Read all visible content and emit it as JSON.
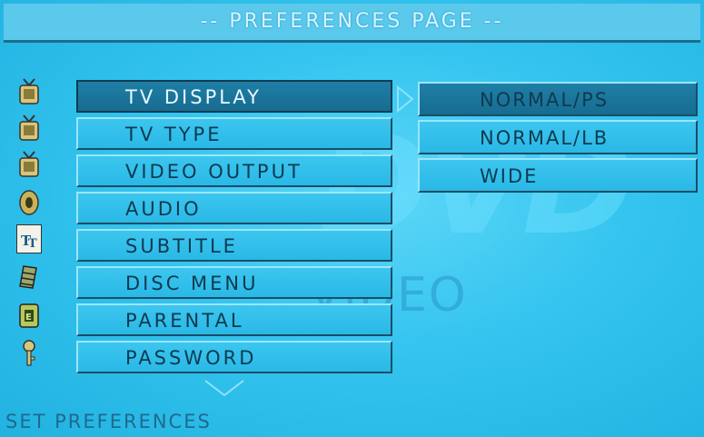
{
  "header": {
    "title": "-- PREFERENCES PAGE --"
  },
  "watermark": {
    "logo": "DVD",
    "subtitle": "VIDEO"
  },
  "sidebar": {
    "icons": [
      "tv-antenna-icon",
      "tv-antenna-icon",
      "tv-antenna-icon",
      "audio-disc-icon",
      "subtitle-tt-icon",
      "disc-menu-icon",
      "parental-lock-icon",
      "password-key-icon"
    ],
    "selected_icon_index": 4
  },
  "menu": {
    "selected_index": 0,
    "items": [
      {
        "label": "TV DISPLAY"
      },
      {
        "label": "TV TYPE"
      },
      {
        "label": "VIDEO OUTPUT"
      },
      {
        "label": "AUDIO"
      },
      {
        "label": "SUBTITLE"
      },
      {
        "label": "DISC MENU"
      },
      {
        "label": "PARENTAL"
      },
      {
        "label": "PASSWORD"
      }
    ]
  },
  "submenu": {
    "selected_index": 0,
    "items": [
      {
        "label": "NORMAL/PS"
      },
      {
        "label": "NORMAL/LB"
      },
      {
        "label": "WIDE"
      }
    ]
  },
  "status": {
    "text": "SET PREFERENCES"
  },
  "colors": {
    "background": "#29bde9",
    "selected": "#1f7fa6",
    "text_dark": "#0e3a50",
    "text_light": "#e9f9ff"
  }
}
